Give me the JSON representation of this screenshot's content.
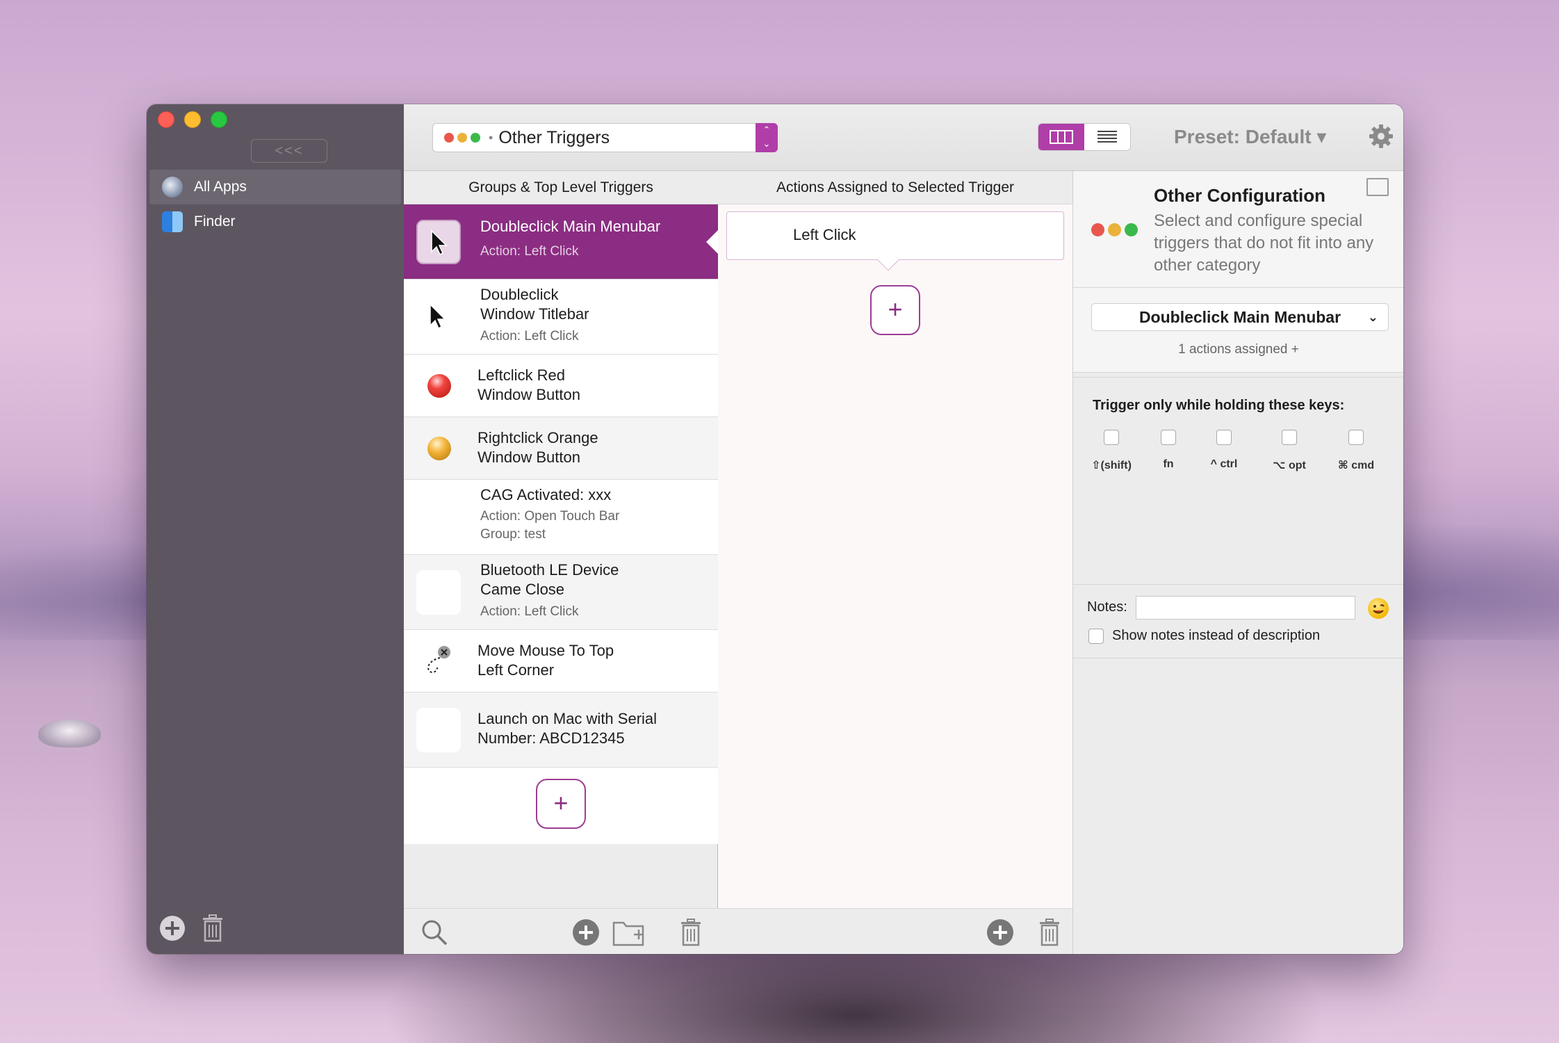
{
  "sidebar": {
    "collapse_label": "<<<",
    "items": [
      {
        "label": "All Apps",
        "icon": "globe-icon",
        "selected": true
      },
      {
        "label": "Finder",
        "icon": "finder-icon",
        "selected": false
      }
    ]
  },
  "toolbar": {
    "trigger_type": "Other Triggers",
    "preset_label": "Preset: Default ▾"
  },
  "columns": {
    "triggers_header": "Groups & Top Level Triggers",
    "actions_header": "Actions Assigned to Selected Trigger"
  },
  "triggers": [
    {
      "line1": "Doubleclick Main Menubar",
      "line2": "",
      "sub": "Action: Left Click",
      "sub2": "",
      "icon": "cursor-icon",
      "selected": true
    },
    {
      "line1": "Doubleclick",
      "line2": "Window Titlebar",
      "sub": "Action: Left Click",
      "sub2": "",
      "icon": "cursor-icon",
      "selected": false
    },
    {
      "line1": "Leftclick Red",
      "line2": "Window Button",
      "sub": "",
      "sub2": "",
      "icon": "red-button-icon",
      "selected": false
    },
    {
      "line1": "Rightclick Orange",
      "line2": "Window Button",
      "sub": "",
      "sub2": "",
      "icon": "orange-button-icon",
      "selected": false
    },
    {
      "line1": "CAG Activated: xxx",
      "line2": "",
      "sub": "Action: Open Touch Bar",
      "sub2": "Group: test",
      "icon": "",
      "selected": false
    },
    {
      "line1": "Bluetooth LE Device",
      "line2": "Came Close",
      "sub": "Action: Left Click",
      "sub2": "",
      "icon": "blank-icon",
      "selected": false
    },
    {
      "line1": "Move Mouse To Top",
      "line2": "Left Corner",
      "sub": "",
      "sub2": "",
      "icon": "mouse-path-icon",
      "selected": false
    },
    {
      "line1": "Launch on Mac with Serial",
      "line2": "Number: ABCD12345",
      "sub": "",
      "sub2": "",
      "icon": "blank-icon",
      "selected": false
    }
  ],
  "actions": [
    {
      "label": "Left Click"
    }
  ],
  "config": {
    "title": "Other Configuration",
    "description": "Select and configure special triggers that do not  fit into any other category",
    "selected_trigger": "Doubleclick Main Menubar",
    "assigned_text": "1 actions assigned +",
    "keys_title": "Trigger only while holding these keys:",
    "keys": [
      "⇧(shift)",
      "fn",
      "^ ctrl",
      "⌥ opt",
      "⌘ cmd"
    ],
    "notes_label": "Notes:",
    "notes_value": "",
    "show_notes_label": "Show notes instead of description"
  },
  "colors": {
    "accent": "#8b2d82",
    "sidebar_bg": "#5d5660"
  }
}
